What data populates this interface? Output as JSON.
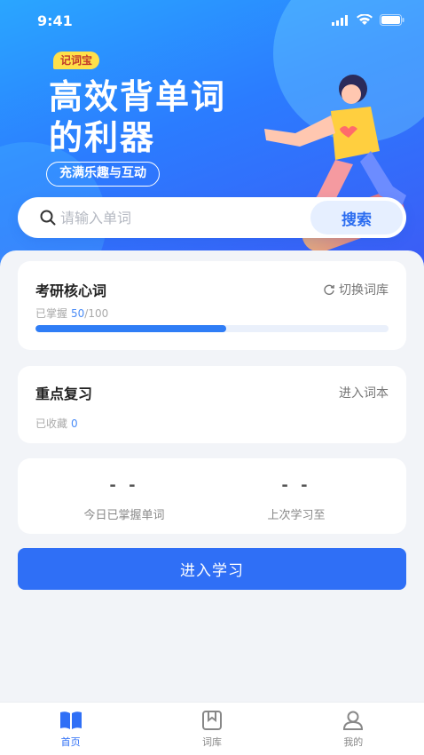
{
  "status_bar": {
    "time": "9:41"
  },
  "hero": {
    "badge": "记词宝",
    "headline_line1": "高效背单词",
    "headline_line2": "的利器",
    "subtitle": "充满乐趣与互动"
  },
  "search": {
    "placeholder": "请输入单词",
    "button_label": "搜索"
  },
  "vocab_card": {
    "title": "考研核心词",
    "action_label": "切换词库",
    "mastered_label": "已掌握",
    "mastered_count": "50",
    "total": "/100",
    "progress_fraction": 0.54
  },
  "review_card": {
    "title": "重点复习",
    "action_label": "进入词本",
    "collected_label": "已收藏",
    "collected_count": "0"
  },
  "stats": {
    "today_value": "- -",
    "today_label": "今日已掌握单词",
    "last_value": "- -",
    "last_label": "上次学习至"
  },
  "cta": {
    "label": "进入学习"
  },
  "tabbar": {
    "items": [
      {
        "label": "首页",
        "icon": "book-open-icon",
        "active": true
      },
      {
        "label": "词库",
        "icon": "bookmark-icon",
        "active": false
      },
      {
        "label": "我的",
        "icon": "user-icon",
        "active": false
      }
    ]
  },
  "colors": {
    "accent": "#2f6ff6",
    "badge": "#ffe04a",
    "progress": "#2f7df6"
  }
}
